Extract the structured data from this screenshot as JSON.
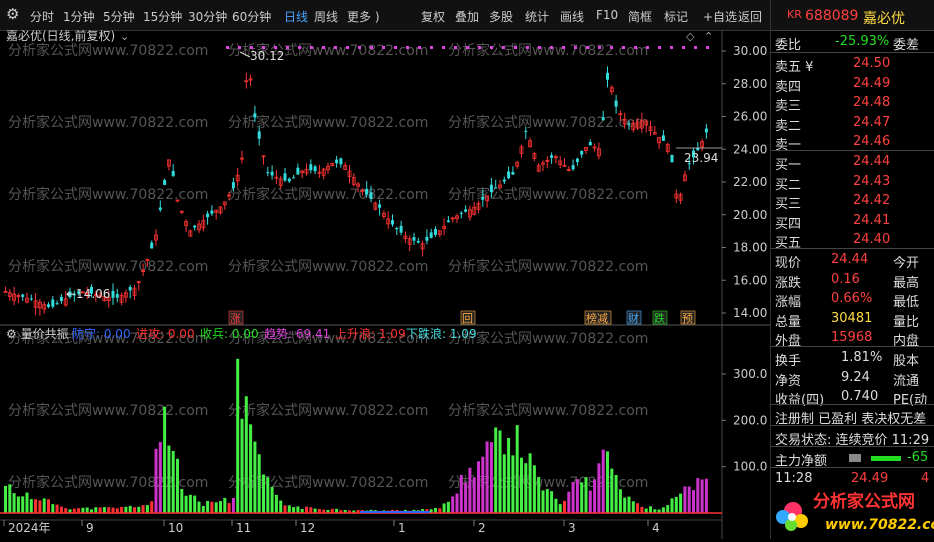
{
  "toolbar": {
    "items": [
      "分时",
      "1分钟",
      "5分钟",
      "15分钟",
      "30分钟",
      "60分钟",
      "日线",
      "周线",
      "更多 )",
      "复权",
      "叠加",
      "多股",
      "统计",
      "画线",
      "F10",
      "简框",
      "标记",
      "+自选",
      "返回"
    ],
    "active": "日线"
  },
  "chart_header": {
    "title": "嘉必优(日线,前复权)"
  },
  "price_axis": {
    "ticks": [
      "30.00",
      "28.00",
      "26.00",
      "24.00",
      "22.00",
      "20.00",
      "18.00",
      "16.00",
      "14.00"
    ]
  },
  "annotations": {
    "high": "30.12",
    "low": "14.06",
    "last": "23.94"
  },
  "markers": [
    {
      "text": "涨",
      "color": "#ff4040"
    },
    {
      "text": "回",
      "color": "#ffaa44"
    },
    {
      "text": "榜减",
      "color": "#ffaa44"
    },
    {
      "text": "财",
      "color": "#44aaff"
    },
    {
      "text": "跌",
      "color": "#22dd22"
    },
    {
      "text": "预",
      "color": "#ffaa44"
    }
  ],
  "indicator": {
    "name": "量价共振",
    "values": [
      {
        "label": "防守: 0.00",
        "color": "#3366ff"
      },
      {
        "label": "进攻: 0.00",
        "color": "#ff3333"
      },
      {
        "label": "收兵: 0.00",
        "color": "#22dd22"
      },
      {
        "label": "趋势: 69.41",
        "color": "#dd44dd"
      },
      {
        "label": "上升浪: 1.09",
        "color": "#ff3333"
      },
      {
        "label": "下跌浪: 1.09",
        "color": "#44dddd"
      }
    ],
    "axis_ticks": [
      "300.0",
      "200.0",
      "100.0"
    ]
  },
  "time_axis": {
    "labels": [
      "2024年",
      "9",
      "10",
      "11",
      "12",
      "1",
      "2",
      "3",
      "4"
    ]
  },
  "watermark": "分析家公式网www.70822.com",
  "side": {
    "code": "688089",
    "name": "嘉必优",
    "badge": "KR",
    "weibi_label": "委比",
    "weibi_value": "-25.93%",
    "weicha_label": "委差",
    "asks": [
      {
        "label": "卖五 ¥",
        "price": "24.50"
      },
      {
        "label": "卖四",
        "price": "24.49"
      },
      {
        "label": "卖三",
        "price": "24.48"
      },
      {
        "label": "卖二",
        "price": "24.47"
      },
      {
        "label": "卖一",
        "price": "24.46"
      }
    ],
    "bids": [
      {
        "label": "买一",
        "price": "24.44"
      },
      {
        "label": "买二",
        "price": "24.43"
      },
      {
        "label": "买三",
        "price": "24.42"
      },
      {
        "label": "买四",
        "price": "24.41"
      },
      {
        "label": "买五",
        "price": "24.40"
      }
    ],
    "stats": [
      {
        "l": "现价",
        "v": "24.44",
        "r": "今开",
        "c": "red"
      },
      {
        "l": "涨跌",
        "v": "0.16",
        "r": "最高",
        "c": "red"
      },
      {
        "l": "涨幅",
        "v": "0.66%",
        "r": "最低",
        "c": "red"
      },
      {
        "l": "总量",
        "v": "30481",
        "r": "量比",
        "c": "yellow"
      },
      {
        "l": "外盘",
        "v": "15968",
        "r": "内盘",
        "c": "red"
      }
    ],
    "stats2": [
      {
        "l": "换手",
        "v": "1.81%",
        "r": "股本"
      },
      {
        "l": "净资",
        "v": "9.24",
        "r": "流通"
      },
      {
        "l": "收益(四)",
        "v": "0.740",
        "r": "PE(动"
      }
    ],
    "tags": "注册制 已盈利 表决权无差",
    "trade_state": "交易状态: 连续竞价 11:29",
    "main_net": "主力净额",
    "main_net_val": "-65",
    "tick": {
      "time": "11:28",
      "price": "24.49",
      "vol": "4"
    },
    "logo_text": "分析家公式网",
    "logo_url": "www.70822.com"
  }
}
